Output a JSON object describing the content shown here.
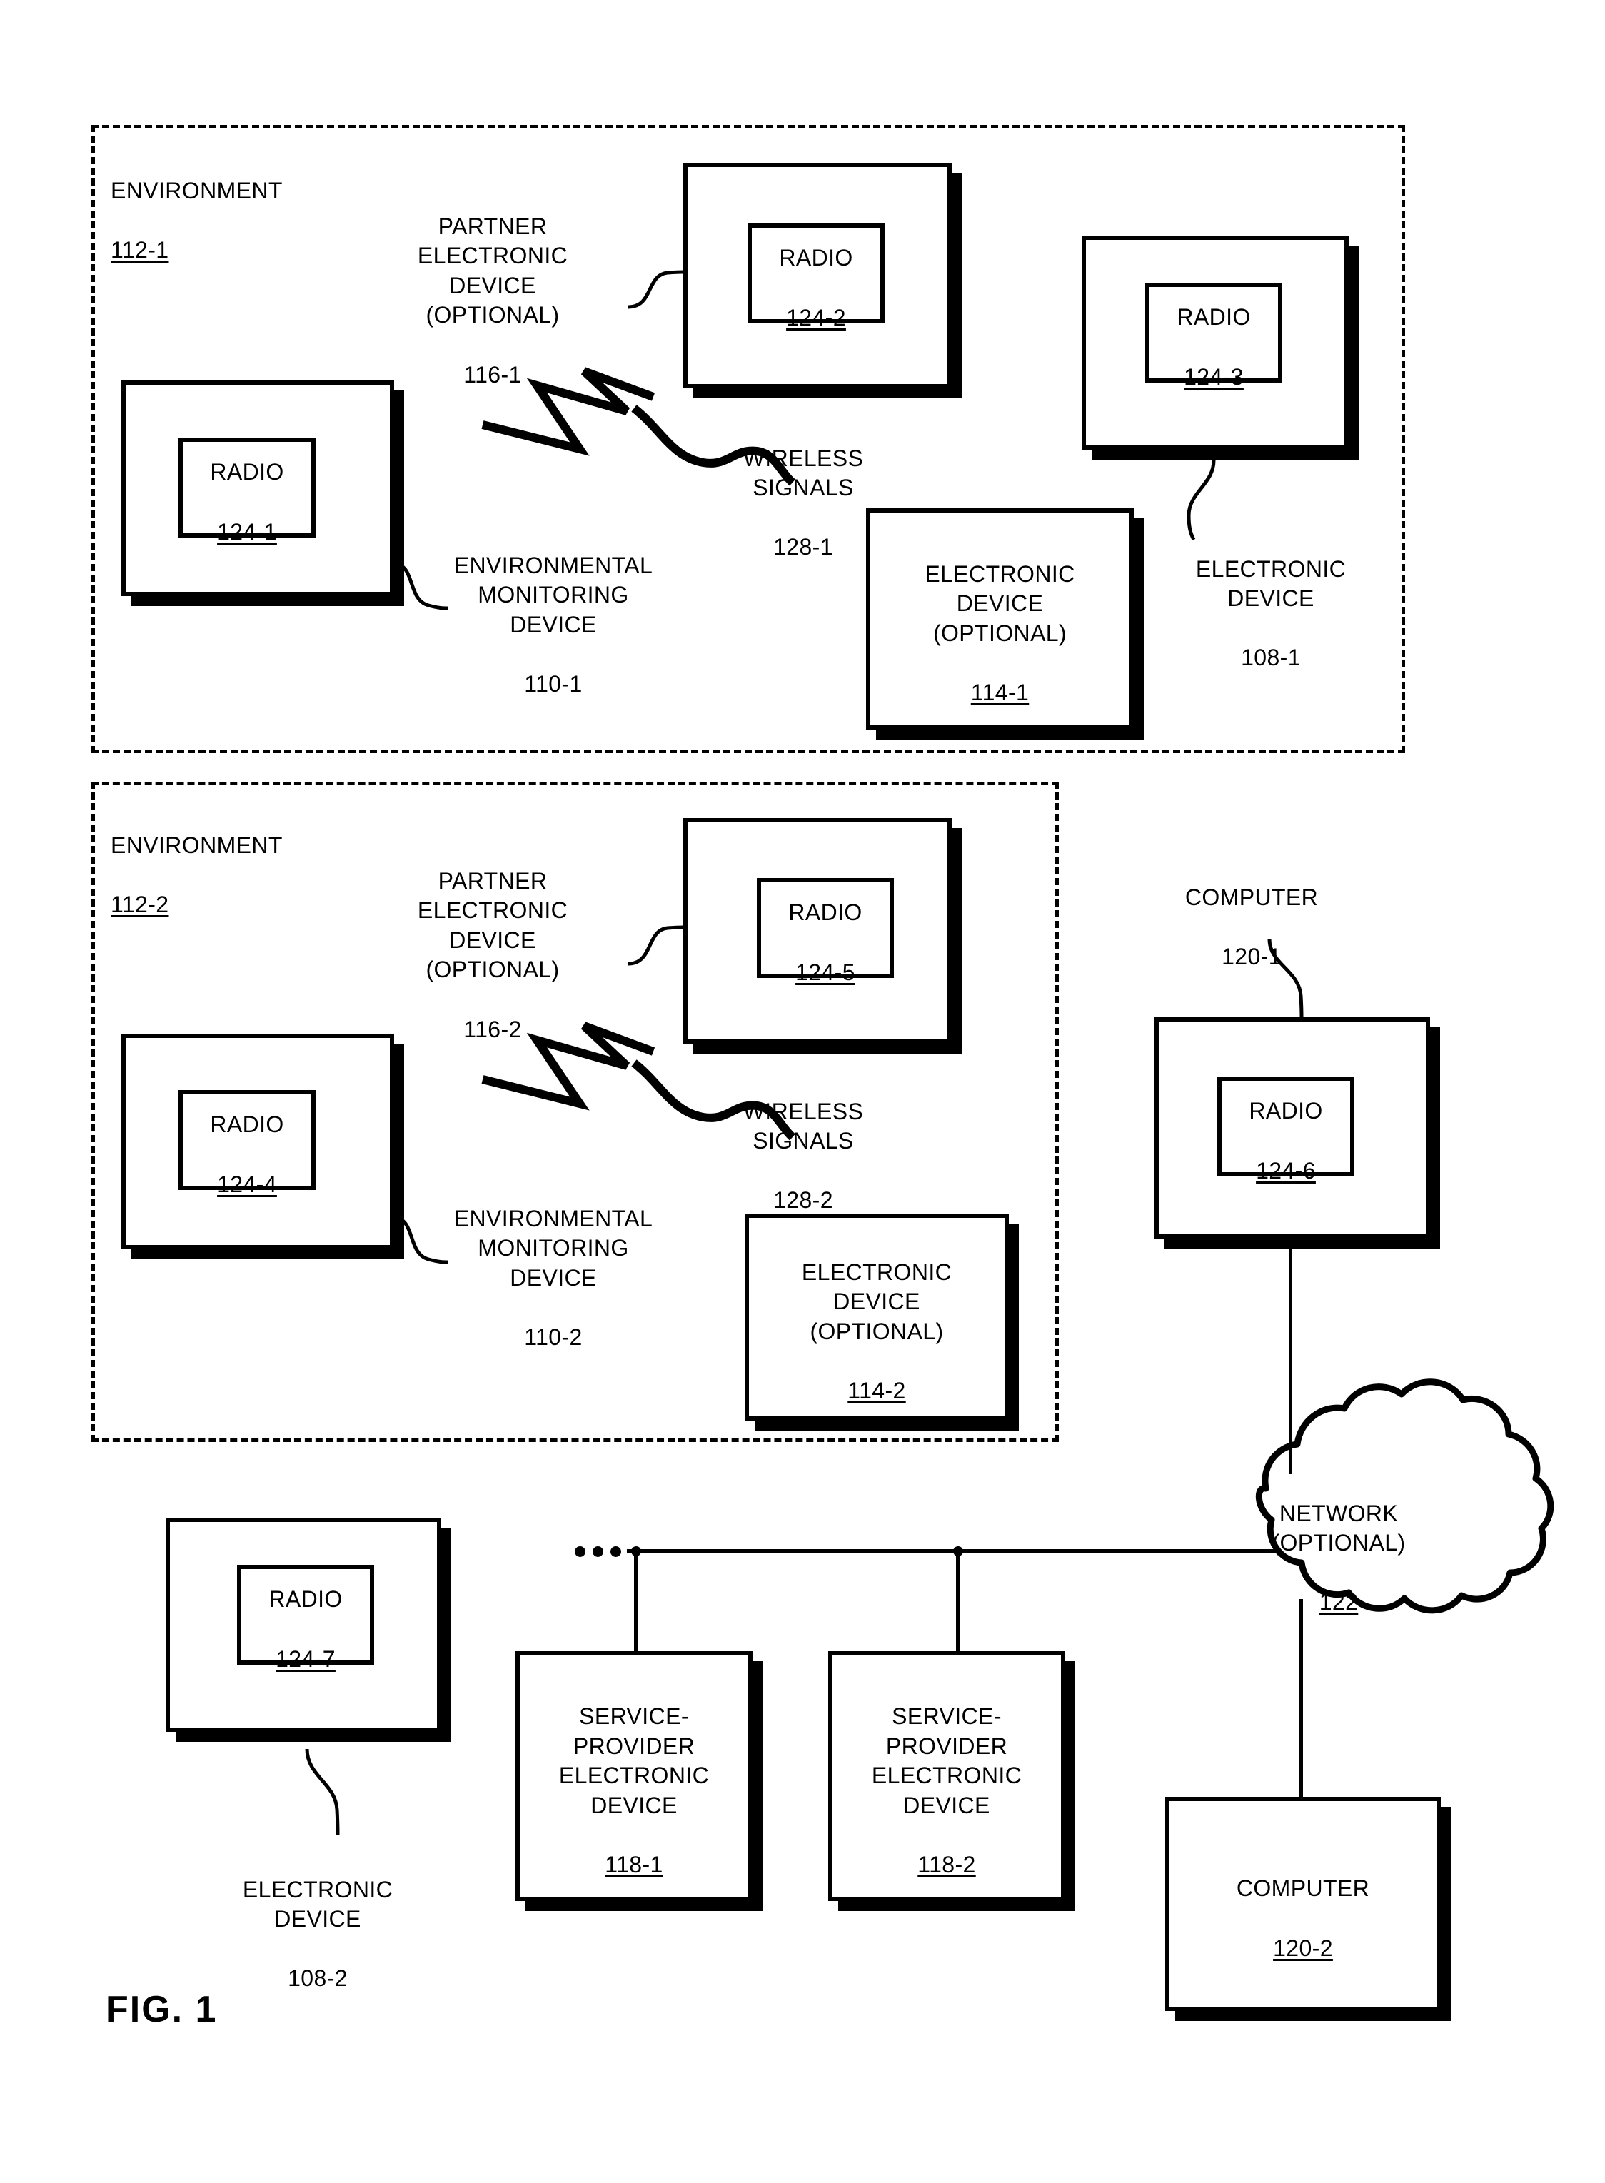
{
  "figure": {
    "label": "FIG. 1"
  },
  "environments": [
    {
      "name": "ENVIRONMENT",
      "ref": "112-1",
      "callouts": [
        {
          "name": "PARTNER\nELECTRONIC\nDEVICE\n(OPTIONAL)",
          "ref": "116-1"
        },
        {
          "name": "WIRELESS\nSIGNALS",
          "ref": "128-1"
        },
        {
          "name": "ENVIRONMENTAL\nMONITORING\nDEVICE",
          "ref": "110-1"
        },
        {
          "name": "ELECTRONIC\nDEVICE",
          "ref": "108-1"
        }
      ],
      "boxes": [
        {
          "name": "",
          "ref": "",
          "radio": {
            "name": "RADIO",
            "ref": "124-1"
          }
        },
        {
          "name": "",
          "ref": "",
          "radio": {
            "name": "RADIO",
            "ref": "124-2"
          }
        },
        {
          "name": "",
          "ref": "",
          "radio": {
            "name": "RADIO",
            "ref": "124-3"
          }
        },
        {
          "name": "ELECTRONIC\nDEVICE\n(OPTIONAL)",
          "ref": "114-1"
        }
      ]
    },
    {
      "name": "ENVIRONMENT",
      "ref": "112-2",
      "callouts": [
        {
          "name": "PARTNER\nELECTRONIC\nDEVICE\n(OPTIONAL)",
          "ref": "116-2"
        },
        {
          "name": "WIRELESS\nSIGNALS",
          "ref": "128-2"
        },
        {
          "name": "ENVIRONMENTAL\nMONITORING\nDEVICE",
          "ref": "110-2"
        }
      ],
      "boxes": [
        {
          "name": "",
          "ref": "",
          "radio": {
            "name": "RADIO",
            "ref": "124-4"
          }
        },
        {
          "name": "",
          "ref": "",
          "radio": {
            "name": "RADIO",
            "ref": "124-5"
          }
        },
        {
          "name": "ELECTRONIC\nDEVICE\n(OPTIONAL)",
          "ref": "114-2"
        }
      ]
    }
  ],
  "nodes": {
    "radio_124_1": {
      "name": "RADIO",
      "ref": "124-1"
    },
    "radio_124_2": {
      "name": "RADIO",
      "ref": "124-2"
    },
    "radio_124_3": {
      "name": "RADIO",
      "ref": "124-3"
    },
    "radio_124_4": {
      "name": "RADIO",
      "ref": "124-4"
    },
    "radio_124_5": {
      "name": "RADIO",
      "ref": "124-5"
    },
    "radio_124_6": {
      "name": "RADIO",
      "ref": "124-6"
    },
    "radio_124_7": {
      "name": "RADIO",
      "ref": "124-7"
    },
    "env_1_title": "ENVIRONMENT",
    "env_1_ref": "112-1",
    "env_2_title": "ENVIRONMENT",
    "env_2_ref": "112-2",
    "partner_device_1": "PARTNER\nELECTRONIC\nDEVICE\n(OPTIONAL)",
    "partner_device_1_ref": "116-1",
    "partner_device_2": "PARTNER\nELECTRONIC\nDEVICE\n(OPTIONAL)",
    "partner_device_2_ref": "116-2",
    "wireless_1": "WIRELESS\nSIGNALS",
    "wireless_1_ref": "128-1",
    "wireless_2": "WIRELESS\nSIGNALS",
    "wireless_2_ref": "128-2",
    "env_mon_1": "ENVIRONMENTAL\nMONITORING\nDEVICE",
    "env_mon_1_ref": "110-1",
    "env_mon_2": "ENVIRONMENTAL\nMONITORING\nDEVICE",
    "env_mon_2_ref": "110-2",
    "elec_dev_108_1": "ELECTRONIC\nDEVICE",
    "elec_dev_108_1_ref": "108-1",
    "elec_dev_108_2": "ELECTRONIC\nDEVICE",
    "elec_dev_108_2_ref": "108-2",
    "elec_opt_114_1": "ELECTRONIC\nDEVICE\n(OPTIONAL)",
    "elec_opt_114_1_ref": "114-1",
    "elec_opt_114_2": "ELECTRONIC\nDEVICE\n(OPTIONAL)",
    "elec_opt_114_2_ref": "114-2",
    "computer_120_1": "COMPUTER",
    "computer_120_1_ref": "120-1",
    "computer_120_2": "COMPUTER",
    "computer_120_2_ref": "120-2",
    "network": "NETWORK\n(OPTIONAL)",
    "network_ref": "122",
    "sp_118_1": "SERVICE-\nPROVIDER\nELECTRONIC\nDEVICE",
    "sp_118_1_ref": "118-1",
    "sp_118_2": "SERVICE-\nPROVIDER\nELECTRONIC\nDEVICE",
    "sp_118_2_ref": "118-2"
  },
  "colors": {
    "ink": "#000000",
    "paper": "#ffffff"
  }
}
